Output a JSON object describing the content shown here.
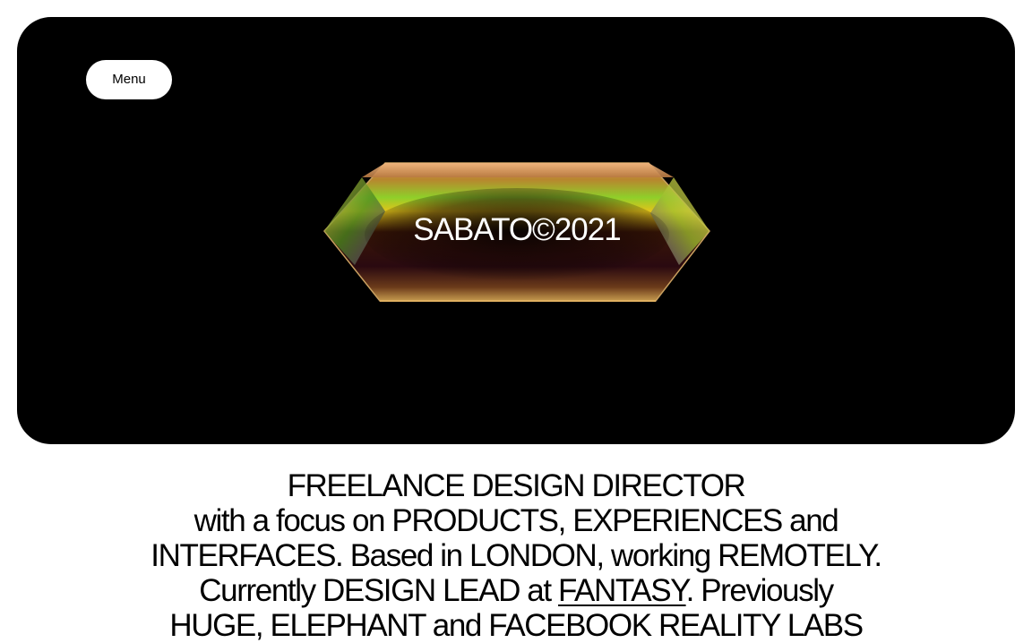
{
  "menu": {
    "label": "Menu"
  },
  "hero": {
    "crystal_label": "SABATO©2021",
    "background": "#000000"
  },
  "bio": {
    "line1": "FREELANCE DESIGN DIRECTOR",
    "line2": "with a focus on PRODUCTS, EXPERIENCES and",
    "line3": "INTERFACES. Based in LONDON, working REMOTELY.",
    "line4_before": "Currently DESIGN LEAD at ",
    "line4_link": "FANTASY",
    "line4_after": ". Previously",
    "line5": "HUGE, ELEPHANT and FACEBOOK REALITY LABS"
  }
}
